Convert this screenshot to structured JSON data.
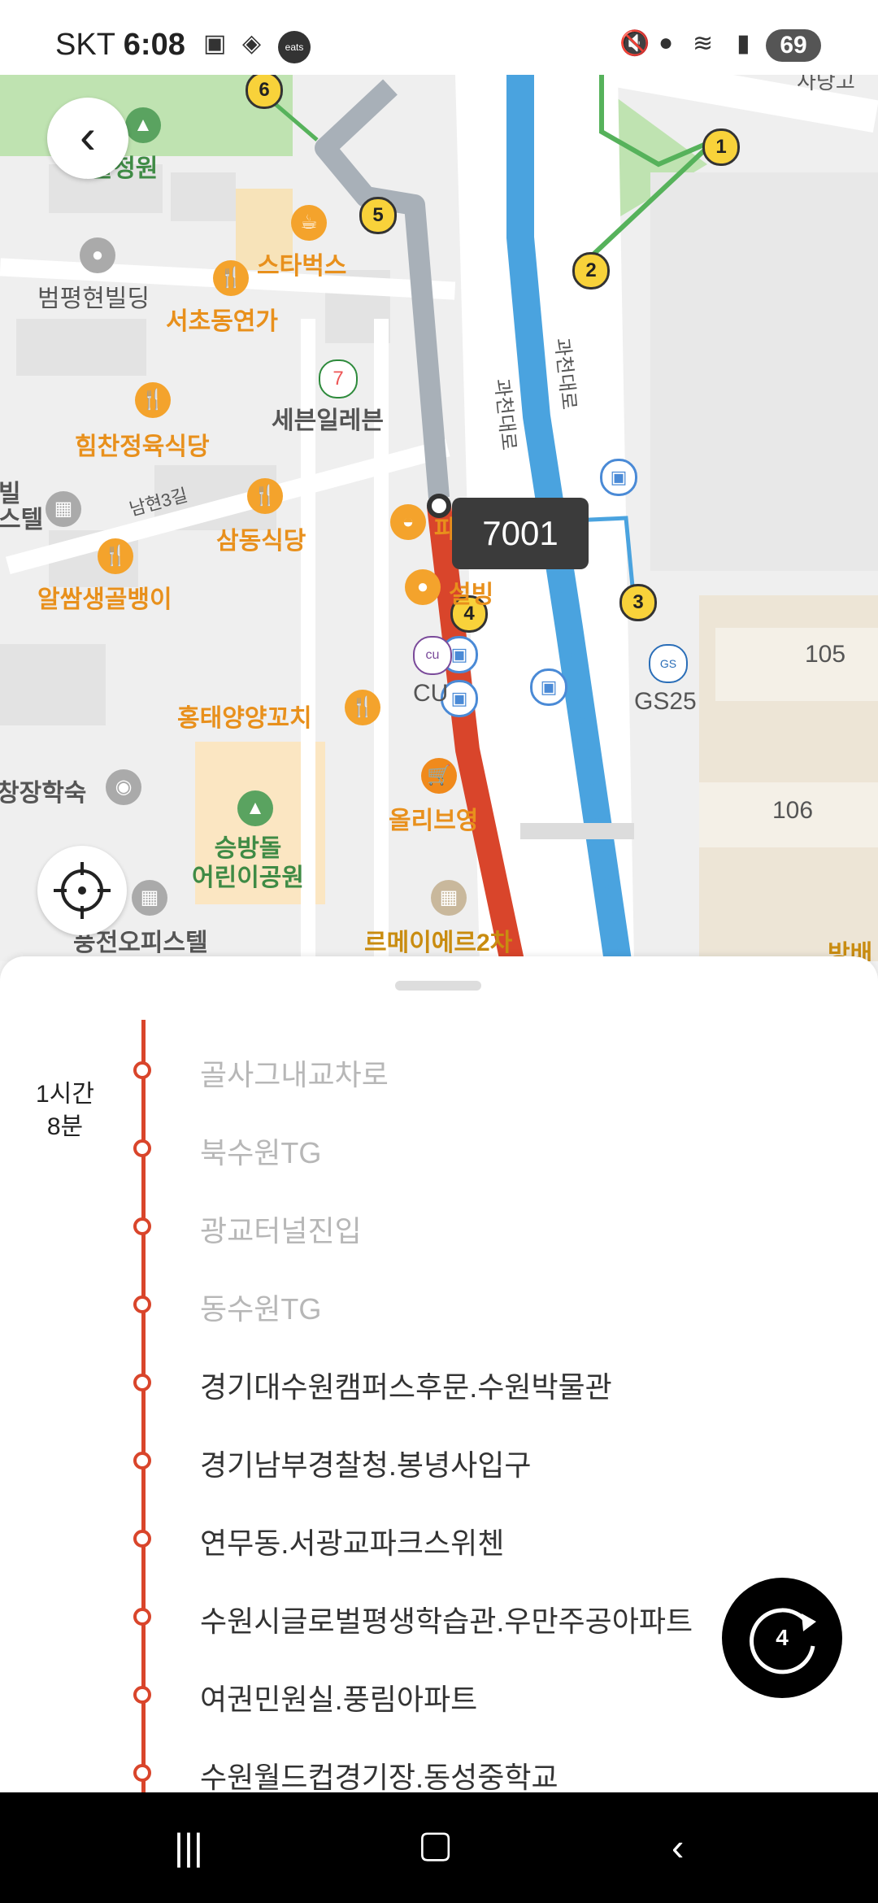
{
  "status_bar": {
    "carrier": "SKT",
    "time": "6:08",
    "app_badge": "eats",
    "battery": "69"
  },
  "map": {
    "route_number": "7001",
    "pois": {
      "arts_center": "예술정원",
      "starbucks": "스타벅스",
      "building": "범평현빌딩",
      "seocho_dong": "서초동연가",
      "seven_eleven": "세븐일레븐",
      "restaurant1": "힘찬정육식당",
      "namhyeon_road": "남현3길",
      "restaurant2": "삼동식당",
      "paris_baguette": "파리바게뜨",
      "sulbing": "설빙",
      "restaurant3": "알쌈생골뱅이",
      "officetel_left": "빌\n스텔",
      "cu": "CU",
      "gs25": "GS25",
      "skewer": "홍태양양꼬치",
      "olive_young": "올리브영",
      "lodging": "창장학숙",
      "park": "승방돌\n어린이공원",
      "officetel": "풍전오피스텔",
      "lemeier": "르메이에르2차",
      "apt_105": "105",
      "apt_106": "106",
      "bangbae": "방배",
      "gwacheon_road1": "과천대로",
      "gwacheon_road2": "과천대로",
      "top_right": "사당고"
    },
    "markers": [
      "1",
      "2",
      "3",
      "4",
      "5",
      "6"
    ]
  },
  "sheet": {
    "duration": "1시간\n8분",
    "stops": [
      {
        "name": "골사그내교차로",
        "state": "past"
      },
      {
        "name": "북수원TG",
        "state": "past"
      },
      {
        "name": "광교터널진입",
        "state": "past"
      },
      {
        "name": "동수원TG",
        "state": "past"
      },
      {
        "name": "경기대수원캠퍼스후문.수원박물관",
        "state": "next"
      },
      {
        "name": "경기남부경찰청.봉녕사입구",
        "state": "next"
      },
      {
        "name": "연무동.서광교파크스위첸",
        "state": "next"
      },
      {
        "name": "수원시글로벌평생학습관.우만주공아파트",
        "state": "next"
      },
      {
        "name": "여권민원실.풍림아파트",
        "state": "next"
      },
      {
        "name": "수원월드컵경기장.동성중학교",
        "state": "next"
      }
    ]
  },
  "refresh_count": "4",
  "colors": {
    "route_red": "#d9452b",
    "road_blue": "#4aa3df",
    "poi_orange": "#e8901c"
  }
}
